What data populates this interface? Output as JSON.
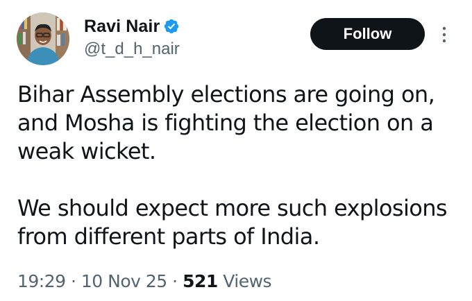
{
  "author": {
    "display_name": "Ravi Nair",
    "handle": "@t_d_h_nair",
    "verified": true
  },
  "follow_button": {
    "label": "Follow"
  },
  "tweet": {
    "paragraphs": [
      "Bihar Assembly elections are going on, and Mosha is fighting the election on a weak wicket.",
      "We should expect more such explosions from different parts of India."
    ]
  },
  "meta": {
    "time": "19:29",
    "separator": "·",
    "date": "10 Nov 25",
    "views_count": "521",
    "views_label": "Views"
  },
  "colors": {
    "text": "#0f1419",
    "secondary": "#536471",
    "verified_badge": "#1d9bf0",
    "button_bg": "#0f1419"
  },
  "icons": {
    "verified": "verified-badge-icon",
    "more": "more-vertical-icon"
  }
}
